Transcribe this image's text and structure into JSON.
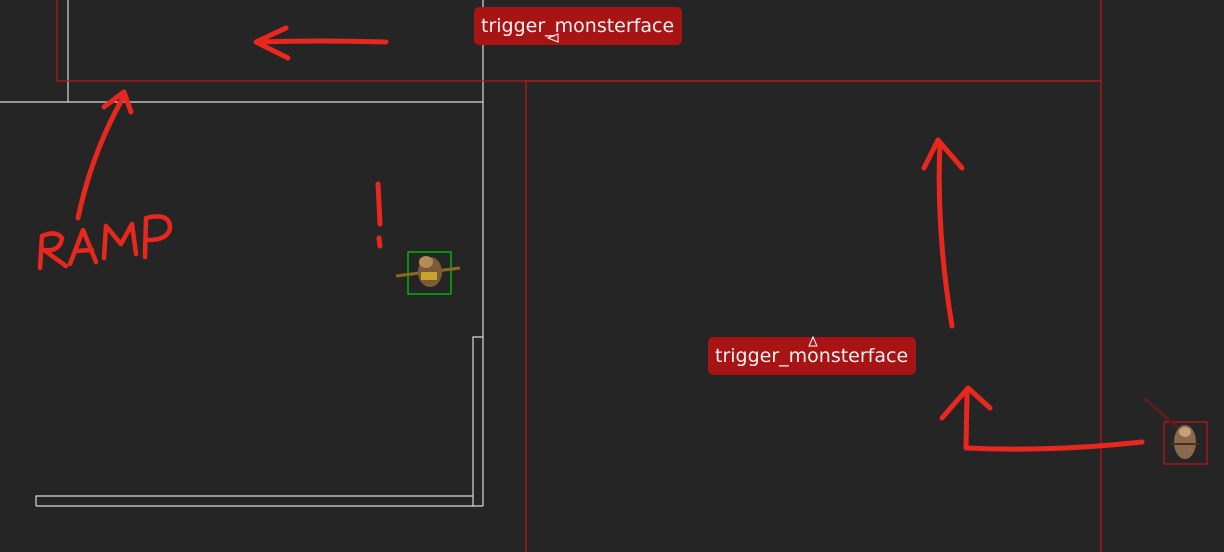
{
  "editor": {
    "background": "#252525",
    "wall_color": "#d9d9d9",
    "trigger_color": "#c01818",
    "annotation_color": "#e8281f",
    "selection_color": "#00d000"
  },
  "triggers": [
    {
      "label": "trigger_monsterface",
      "color": "#a81414"
    },
    {
      "label": "trigger_monsterface",
      "color": "#a81414"
    }
  ],
  "annotations": {
    "ramp_label": "RAMP",
    "alert_label": "!"
  },
  "entities": [
    {
      "name": "monster-selected",
      "selected": true,
      "box_color": "#00d000"
    },
    {
      "name": "monster-unselected",
      "selected": false,
      "box_color": "#c01818"
    }
  ],
  "icons": {
    "trigger_arrow_1": "triangle-left-icon",
    "trigger_arrow_2": "triangle-up-icon"
  }
}
